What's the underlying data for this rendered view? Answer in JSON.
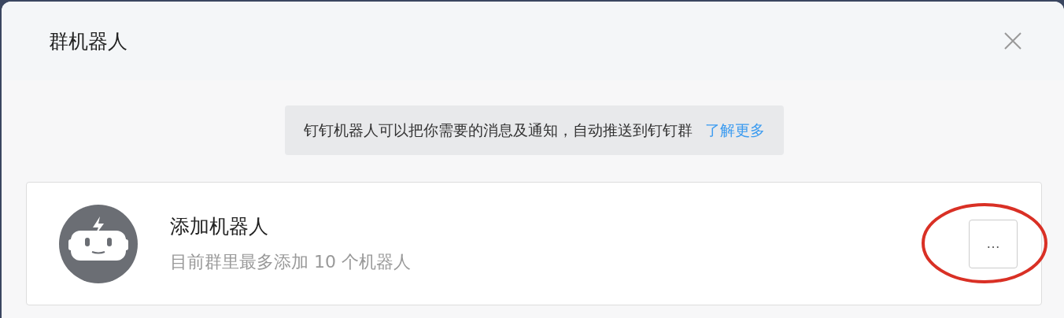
{
  "dialog": {
    "title": "群机器人"
  },
  "notice": {
    "text": "钉钉机器人可以把你需要的消息及通知，自动推送到钉钉群",
    "link": "了解更多"
  },
  "robot_card": {
    "title": "添加机器人",
    "subtitle": "目前群里最多添加 10 个机器人",
    "more_button": "…",
    "highlighted": true
  }
}
